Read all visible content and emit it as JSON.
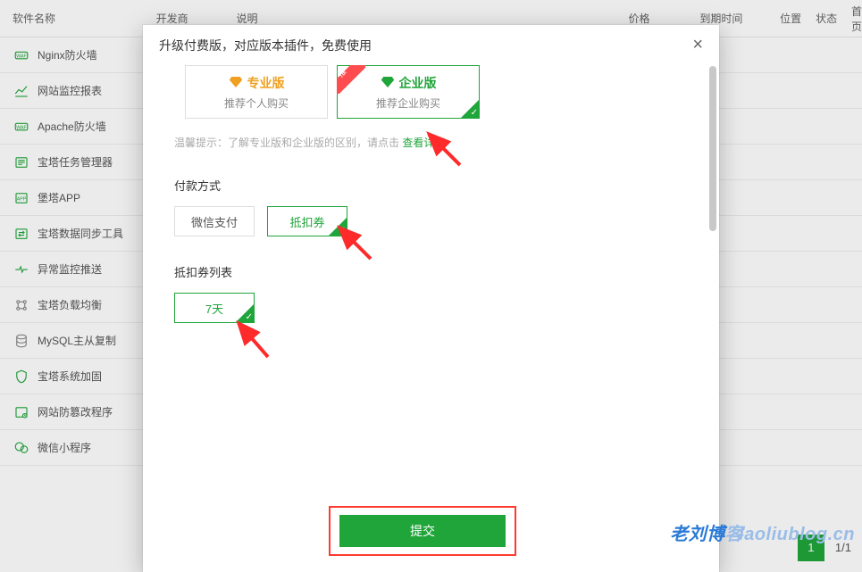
{
  "table": {
    "headers": {
      "name": "软件名称",
      "dev": "开发商",
      "desc": "说明",
      "price": "价格",
      "expire": "到期时间",
      "pos": "位置",
      "status": "状态",
      "home": "首页"
    },
    "rows": [
      {
        "icon_color": "#20a53a",
        "name": "Nginx防火墙"
      },
      {
        "icon_color": "#20a53a",
        "name": "网站监控报表"
      },
      {
        "icon_color": "#20a53a",
        "name": "Apache防火墙"
      },
      {
        "icon_color": "#20a53a",
        "name": "宝塔任务管理器"
      },
      {
        "icon_color": "#20a53a",
        "name": "堡塔APP"
      },
      {
        "icon_color": "#20a53a",
        "name": "宝塔数据同步工具"
      },
      {
        "icon_color": "#20a53a",
        "name": "异常监控推送"
      },
      {
        "icon_color": "#666",
        "name": "宝塔负载均衡"
      },
      {
        "icon_color": "#666",
        "name": "MySQL主从复制"
      },
      {
        "icon_color": "#20a53a",
        "name": "宝塔系统加固"
      },
      {
        "icon_color": "#20a53a",
        "name": "网站防篡改程序"
      },
      {
        "icon_color": "#20a53a",
        "name": "微信小程序"
      }
    ],
    "page_current": "1",
    "page_info": "1/1"
  },
  "modal": {
    "title": "升级付费版，对应版本插件，免费使用",
    "plans": [
      {
        "title": "专业版",
        "sub": "推荐个人购买"
      },
      {
        "title": "企业版",
        "sub": "推荐企业购买",
        "ribbon": "推"
      }
    ],
    "hint_prefix": "温馨提示：",
    "hint_text": "了解专业版和企业版的区别，请点击 ",
    "hint_link": "查看详情",
    "section_payment": "付款方式",
    "payment_options": [
      {
        "label": "微信支付"
      },
      {
        "label": "抵扣券"
      }
    ],
    "section_coupon": "抵扣券列表",
    "coupon_options": [
      {
        "label": "7天"
      }
    ],
    "submit": "提交"
  },
  "watermark": {
    "a": "老刘博",
    "b": "客",
    "c": "laoliublog.cn"
  }
}
